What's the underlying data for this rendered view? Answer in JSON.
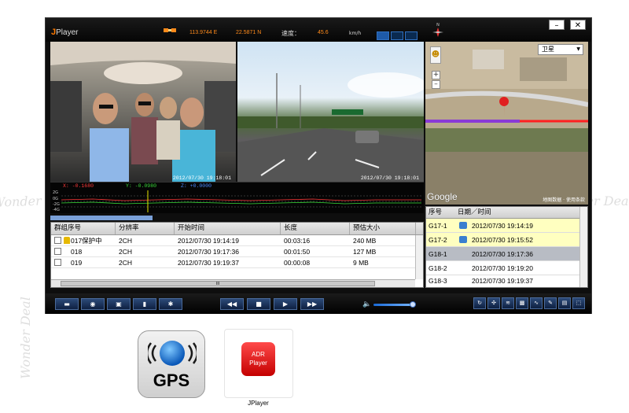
{
  "titlebar": {
    "logo_j": "J",
    "logo_text": "Player",
    "longitude": "113.9744 E",
    "latitude": "22.5871 N",
    "speed_label": "速度：",
    "speed_value": "45.6",
    "speed_unit": "km/h",
    "minimize": "–",
    "close": "✕"
  },
  "compass_text": "N",
  "video": {
    "cabin_timestamp": "2012/07/30   19:18:01",
    "road_timestamp": "2012/07/30   19:18:01"
  },
  "map": {
    "type_select": "卫星",
    "google_logo": "Google",
    "copyright": "地图数据 · 使用条款"
  },
  "waveform": {
    "x_label": "X: -0.1680",
    "y_label": "Y: -0.0980",
    "z_label": "Z: +0.0000",
    "scale_top": "2G",
    "scale_mid": "0G",
    "scale_low": "-2G",
    "scale_bot": "-4G"
  },
  "file_table": {
    "headers": [
      "群组序号",
      "分辨率",
      "开始时间",
      "长度",
      "预估大小"
    ],
    "rows": [
      {
        "id": "017保护中",
        "res": "2CH",
        "start": "2012/07/30 19:14:19",
        "length": "00:03:16",
        "size": "240 MB",
        "locked": true
      },
      {
        "id": "018",
        "res": "2CH",
        "start": "2012/07/30 19:17:36",
        "length": "00:01:50",
        "size": "127 MB",
        "locked": false
      },
      {
        "id": "019",
        "res": "2CH",
        "start": "2012/07/30 19:19:37",
        "length": "00:00:08",
        "size": "9 MB",
        "locked": false
      }
    ],
    "hscroll_grip": "III"
  },
  "segment_table": {
    "headers": [
      "序号",
      "日期／时间"
    ],
    "rows": [
      {
        "id": "G17-1",
        "datetime": "2012/07/30  19:14:19",
        "highlight": "yellow"
      },
      {
        "id": "G17-2",
        "datetime": "2012/07/30  19:15:52",
        "highlight": "yellow"
      },
      {
        "id": "G18-1",
        "datetime": "2012/07/30  19:17:36",
        "highlight": "selected"
      },
      {
        "id": "G18-2",
        "datetime": "2012/07/30  19:19:20",
        "highlight": "none"
      },
      {
        "id": "G18-3",
        "datetime": "2012/07/30  19:19:37",
        "highlight": "none"
      }
    ]
  },
  "controls": {
    "rewind": "◀◀",
    "stop": "■",
    "play": "▶",
    "fast_forward": "▶▶",
    "volume_icon": "🔈",
    "volume_level": 0.85
  },
  "bottom_icons": {
    "gps_text": "GPS",
    "adr_line1": "ADR",
    "adr_line2": "Player",
    "jplayer_label": "JPlayer"
  },
  "watermark": "Wonder Deal"
}
